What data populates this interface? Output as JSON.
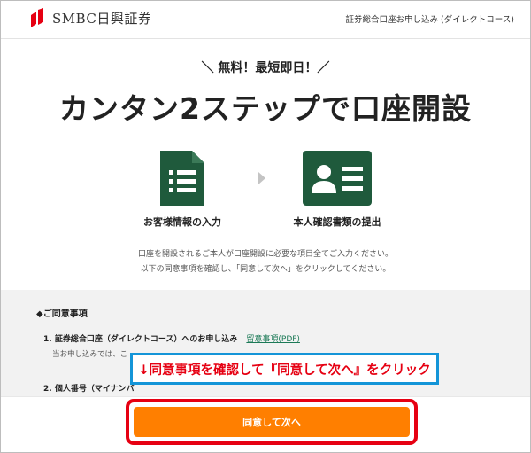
{
  "header": {
    "logo_text": "SMBC日興証券",
    "title": "証券総合口座お申し込み (ダイレクトコース)"
  },
  "hero": {
    "tagline": "＼ 無料！最短即日！／",
    "headline": "カンタン2ステップで口座開設",
    "steps": [
      {
        "icon": "document-list-icon",
        "label": "お客様情報の入力"
      },
      {
        "icon": "id-card-icon",
        "label": "本人確認書類の提出"
      }
    ],
    "description_lines": [
      "口座を開設されるご本人が口座開設に必要な項目全てご入力ください。",
      "以下の同意事項を確認し、「同意して次へ」をクリックしてください。"
    ]
  },
  "terms": {
    "title": "◆ご同意事項",
    "item1_label": "1. 証券総合口座（ダイレクトコース）へのお申し込み",
    "item1_link": "留意事項(PDF)",
    "item1_sub": "当お申し込みでは、こ",
    "item2_label": "2. 個人番号（マイナンバ"
  },
  "annotation": "↓同意事項を確認して『同意して次へ』をクリック",
  "footer": {
    "agree_label": "同意して次へ"
  },
  "colors": {
    "brand_red": "#e60012",
    "icon_green": "#1f5a3c",
    "button_orange": "#ff7f00",
    "annotation_border": "#1495d8"
  }
}
